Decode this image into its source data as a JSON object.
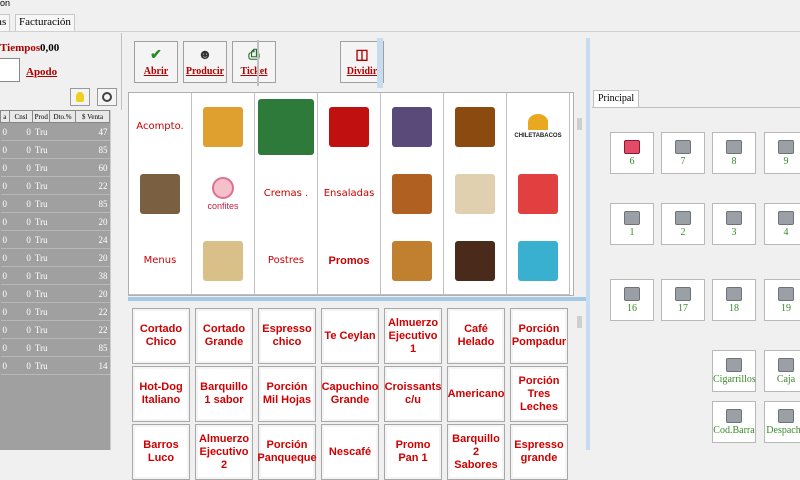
{
  "window": {
    "title_fragment": "on"
  },
  "menu": {
    "tabs": [
      "tas",
      "Facturación"
    ]
  },
  "left": {
    "tiempos_label": "Tiempos",
    "tiempos_value": "0,00",
    "apodo_label": "Apodo",
    "grid": {
      "headers": [
        "a",
        "Cnsl",
        "Prod",
        "Dto.%",
        "$ Venta"
      ],
      "rows": [
        [
          "0",
          "0",
          "Tru",
          "",
          "47"
        ],
        [
          "0",
          "0",
          "Tru",
          "",
          "85"
        ],
        [
          "0",
          "0",
          "Tru",
          "",
          "60"
        ],
        [
          "0",
          "0",
          "Tru",
          "",
          "22"
        ],
        [
          "0",
          "0",
          "Tru",
          "",
          "85"
        ],
        [
          "0",
          "0",
          "Tru",
          "",
          "20"
        ],
        [
          "0",
          "0",
          "Tru",
          "",
          "24"
        ],
        [
          "0",
          "0",
          "Tru",
          "",
          "20"
        ],
        [
          "0",
          "0",
          "Tru",
          "",
          "38"
        ],
        [
          "0",
          "0",
          "Tru",
          "",
          "20"
        ],
        [
          "0",
          "0",
          "Tru",
          "",
          "22"
        ],
        [
          "0",
          "0",
          "Tru",
          "",
          "22"
        ],
        [
          "0",
          "0",
          "Tru",
          "",
          "85"
        ],
        [
          "0",
          "0",
          "Tru",
          "",
          "14"
        ]
      ]
    }
  },
  "toolbar": {
    "abrir": "Abrir",
    "producir": "Producir",
    "ticket": "Ticket",
    "dividir": "Dividir"
  },
  "categories": [
    {
      "label": "Acompto.",
      "kind": "text"
    },
    {
      "label": "",
      "kind": "img",
      "color": "#e0a030"
    },
    {
      "label": "",
      "kind": "img",
      "color": "#2e7a3a"
    },
    {
      "label": "",
      "kind": "img",
      "color": "#c01010"
    },
    {
      "label": "",
      "kind": "img",
      "color": "#5a4a7a"
    },
    {
      "label": "",
      "kind": "img",
      "color": "#8a4a10"
    },
    {
      "label": "CHILETABACOS",
      "kind": "logo"
    },
    {
      "label": "",
      "kind": "img",
      "color": "#7a6040"
    },
    {
      "label": "confites",
      "kind": "confites"
    },
    {
      "label": "Cremas .",
      "kind": "text"
    },
    {
      "label": "Ensaladas",
      "kind": "text"
    },
    {
      "label": "",
      "kind": "img",
      "color": "#b06020"
    },
    {
      "label": "",
      "kind": "img",
      "color": "#e0d0b0"
    },
    {
      "label": "",
      "kind": "img",
      "color": "#e04040"
    },
    {
      "label": "Menus",
      "kind": "text"
    },
    {
      "label": "",
      "kind": "img",
      "color": "#d8c088"
    },
    {
      "label": "Postres",
      "kind": "text"
    },
    {
      "label": "Promos",
      "kind": "bold"
    },
    {
      "label": "",
      "kind": "img",
      "color": "#c08030"
    },
    {
      "label": "",
      "kind": "img",
      "color": "#4a2a1a"
    },
    {
      "label": "",
      "kind": "img",
      "color": "#3ab0d0"
    }
  ],
  "products": [
    "Cortado Chico",
    "Cortado Grande",
    "Espresso chico",
    "Te Ceylan",
    "Almuerzo Ejecutivo 1",
    "Café Helado",
    "Porción Pompadur",
    "Hot-Dog Italiano",
    "Barquillo 1 sabor",
    "Porción Mil Hojas",
    "Capuchino Grande",
    "Croissants c/u",
    "Americano",
    "Porción Tres Leches",
    "Barros Luco",
    "Almuerzo Ejecutivo 2",
    "Porción Panqueque",
    "Nescafé",
    "Promo Pan 1",
    "Barquillo 2 Sabores",
    "Espresso grande"
  ],
  "right": {
    "tab": "Principal",
    "tables": [
      {
        "label": "6",
        "occupied": true
      },
      {
        "label": "7",
        "occupied": false
      },
      {
        "label": "8",
        "occupied": false
      },
      {
        "label": "9",
        "occupied": false
      },
      {
        "label": "1",
        "occupied": false
      },
      {
        "label": "2",
        "occupied": false
      },
      {
        "label": "3",
        "occupied": false
      },
      {
        "label": "4",
        "occupied": false
      },
      {
        "label": "16",
        "occupied": false
      },
      {
        "label": "17",
        "occupied": false
      },
      {
        "label": "18",
        "occupied": false
      },
      {
        "label": "19",
        "occupied": false
      },
      {
        "label": "Cigarrillos",
        "occupied": false
      },
      {
        "label": "Caja",
        "occupied": false
      },
      {
        "label": "Cod.Barra",
        "occupied": false
      },
      {
        "label": "Despacho",
        "occupied": false
      }
    ]
  }
}
